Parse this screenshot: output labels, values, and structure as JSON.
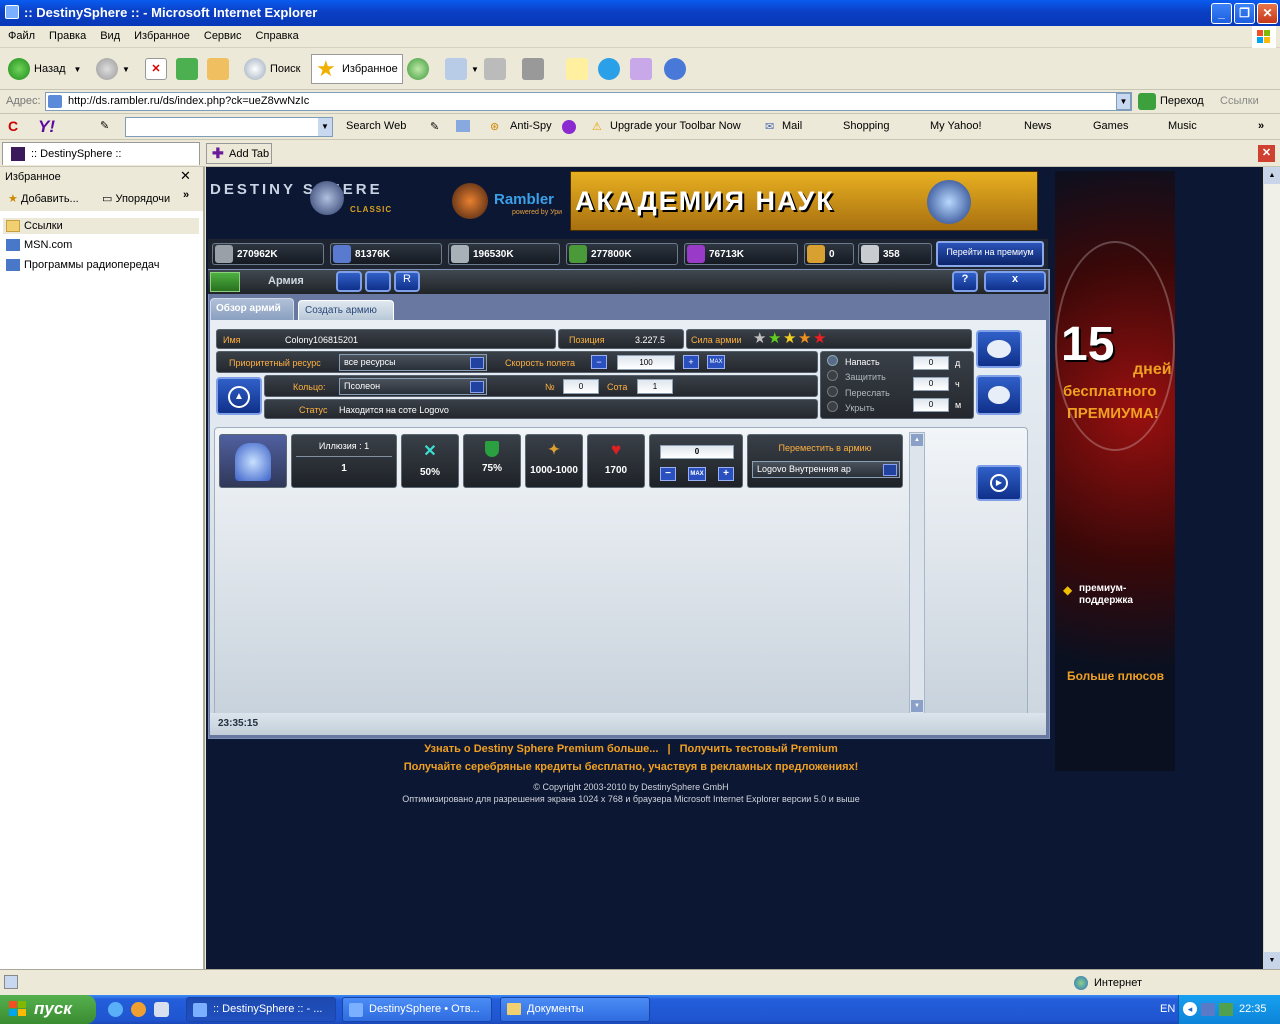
{
  "window": {
    "title": ":: DestinySphere :: - Microsoft Internet Explorer"
  },
  "menu": [
    "Файл",
    "Правка",
    "Вид",
    "Избранное",
    "Сервис",
    "Справка"
  ],
  "toolbar": {
    "back": "Назад",
    "search": "Поиск",
    "favorites": "Избранное"
  },
  "address": {
    "label": "Адрес:",
    "url": "http://ds.rambler.ru/ds/index.php?ck=ueZ8vwNzIc",
    "go": "Переход",
    "links": "Ссылки"
  },
  "ybar": {
    "search_web": "Search Web",
    "antispy": "Anti-Spy",
    "upgrade": "Upgrade your Toolbar Now",
    "mail": "Mail",
    "shopping": "Shopping",
    "myyahoo": "My Yahoo!",
    "news": "News",
    "games": "Games",
    "music": "Music"
  },
  "tabs": {
    "active": ":: DestinySphere ::",
    "add": "Add Tab"
  },
  "favorites": {
    "title": "Избранное",
    "add": "Добавить...",
    "organize": "Упорядочи",
    "items": [
      "Ссылки",
      "MSN.com",
      "Программы радиопередач"
    ]
  },
  "game": {
    "logo": "DESTINY SPHERE",
    "logo_sub": "CLASSIC",
    "rambler": "Rambler",
    "rambler_sub": "powered by Ури",
    "banner": "АКАДЕМИЯ НАУК",
    "resources": [
      "270962K",
      "81376K",
      "196530K",
      "277800K",
      "76713K"
    ],
    "ships": [
      "0",
      "358"
    ],
    "premium_btn": "Перейти на премиум",
    "section_title": "Армия",
    "help": "?",
    "close": "x",
    "tab_overview": "Обзор армий",
    "tab_create": "Создать армию",
    "name_label": "Имя",
    "name_value": "Colony106815201",
    "position_label": "Позиция",
    "position_value": "3.227.5",
    "strength_label": "Сила армии",
    "priority_label": "Приоритетный ресурс",
    "priority_value": "все ресурсы",
    "speed_label": "Скорость полета",
    "speed_value": "100",
    "max": "MAX",
    "ring_label": "Кольцо:",
    "ring_value": "Псолеон",
    "num_label": "№",
    "num_value": "0",
    "cell_label": "Сота",
    "cell_value": "1",
    "status_label": "Статус",
    "status_value": "Находится на соте   Logovo",
    "orders": [
      "Напасть",
      "Защитить",
      "Переслать",
      "Укрыть"
    ],
    "order_values": [
      "0",
      "0",
      "0"
    ],
    "order_units": [
      "д",
      "ч",
      "м"
    ],
    "unit_name": "Иллюзия : 1",
    "unit_count": "1",
    "stat_attack": "50%",
    "stat_defense": "75%",
    "stat_damage": "1000-1000",
    "stat_hp": "1700",
    "move_qty": "0",
    "move_label": "Переместить в армию",
    "move_value": "Logovo   Внутренняя ар",
    "timer": "23:35:15",
    "footer1a": "Узнать о Destiny Sphere Premium больше...",
    "footer_sep": "|",
    "footer1b": "Получить тестовый Premium",
    "footer2": "Получайте серебряные кредиты бесплатно, участвуя в рекламных предложениях!",
    "copyright": "© Copyright 2003-2010 by DestinySphere GmbH",
    "optimized": "Оптимизировано для разрешения экрана 1024 х 768 и браузера Microsoft Internet Explorer версии 5.0 и выше"
  },
  "ad": {
    "big": "15",
    "line1": "дней",
    "line2": "бесплатного",
    "line3": "ПРЕМИУМА!",
    "b1": "премиум-",
    "b1b": "поддержка",
    "b2": "Больше плюсов"
  },
  "status": {
    "zone": "Интернет"
  },
  "taskbar": {
    "start": "пуск",
    "tasks": [
      ":: DestinySphere :: - ...",
      "DestinySphere • Отв...",
      "Документы"
    ],
    "lang": "EN",
    "time": "22:35"
  }
}
